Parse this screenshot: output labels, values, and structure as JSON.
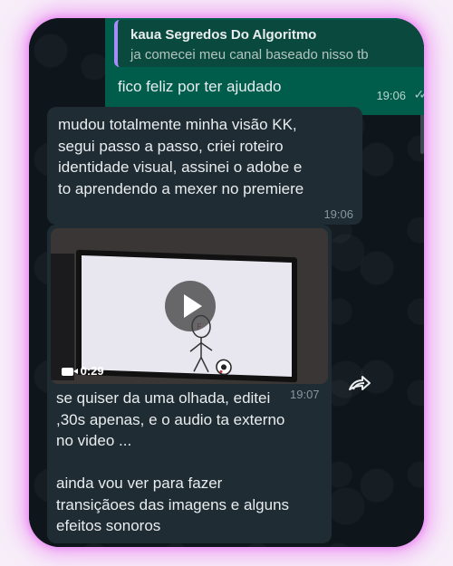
{
  "messages": {
    "outgoing": {
      "quote_author": "kaua Segredos Do Algoritmo",
      "quote_text": "ja comecei meu canal baseado nisso tb",
      "text": "fico feliz por ter ajudado",
      "time": "19:06",
      "status_icon": "double-check-icon"
    },
    "incoming_1": {
      "lines": [
        "mudou totalmente minha visão KK,",
        "segui passo a passo, criei roteiro",
        "identidade visual, assinei o adobe e",
        "to aprendendo a mexer no premiere"
      ],
      "time": "19:06"
    },
    "incoming_2": {
      "video_duration": "0:29",
      "time": "19:07",
      "lines": [
        "se quiser da uma olhada, editei",
        ",30s apenas, e o audio ta externo",
        "no video ...",
        "",
        "ainda vou ver para fazer",
        "transiçãoes das imagens e alguns",
        "efeitos sonoros"
      ]
    }
  },
  "colors": {
    "frame_glow": "#e978f0",
    "outgoing_bubble": "#005c4b",
    "incoming_bubble": "#1f2c33",
    "chat_background": "#0e161b",
    "quote_bar": "#a78bfa"
  },
  "icons": {
    "play": "play-icon",
    "video": "video-camera-icon",
    "forward": "forward-icon"
  }
}
